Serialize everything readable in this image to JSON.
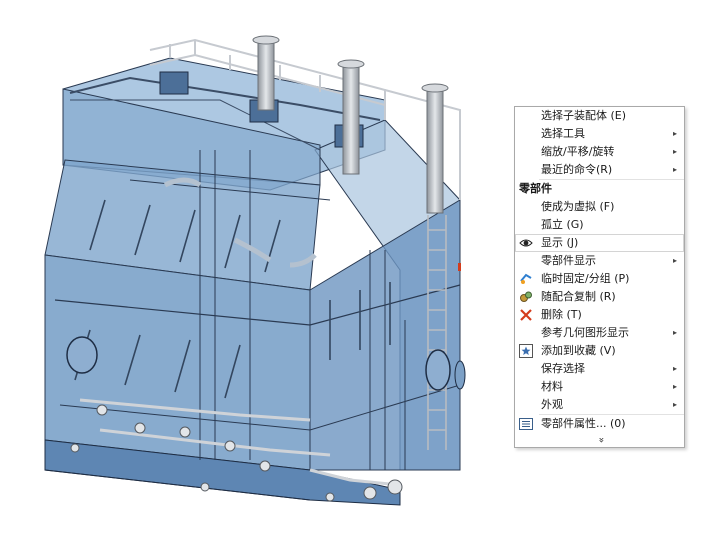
{
  "context_menu": {
    "items": [
      {
        "label": "选择子装配体 (E)",
        "arrow": false
      },
      {
        "label": "选择工具",
        "arrow": true
      },
      {
        "label": "缩放/平移/旋转",
        "arrow": true
      },
      {
        "label": "最近的命令(R)",
        "arrow": true
      },
      {
        "label": "零部件",
        "section": true
      },
      {
        "label": "使成为虚拟 (F)"
      },
      {
        "label": "孤立 (G)"
      },
      {
        "label": "显示 (J)",
        "icon": "eye-icon",
        "highlighted": true
      },
      {
        "label": "零部件显示",
        "arrow": true
      },
      {
        "label": "临时固定/分组 (P)",
        "icon": "fix-group-icon"
      },
      {
        "label": "随配合复制 (R)",
        "icon": "copy-with-mates-icon"
      },
      {
        "label": "删除 (T)",
        "icon": "delete-x-icon"
      },
      {
        "label": "参考几何图形显示",
        "arrow": true
      },
      {
        "label": "添加到收藏 (V)",
        "icon": "favorite-star-icon"
      },
      {
        "label": "保存选择",
        "arrow": true
      },
      {
        "label": "材料",
        "arrow": true
      },
      {
        "label": "外观",
        "arrow": true
      },
      {
        "label": "零部件属性... (0)",
        "icon": "properties-icon"
      }
    ],
    "more_glyph": "»"
  },
  "colors": {
    "tank_fill": "#6f9bc7",
    "tank_edge": "#1e2d44",
    "rail": "#c6cad0",
    "accent_red": "#d43c1c"
  }
}
